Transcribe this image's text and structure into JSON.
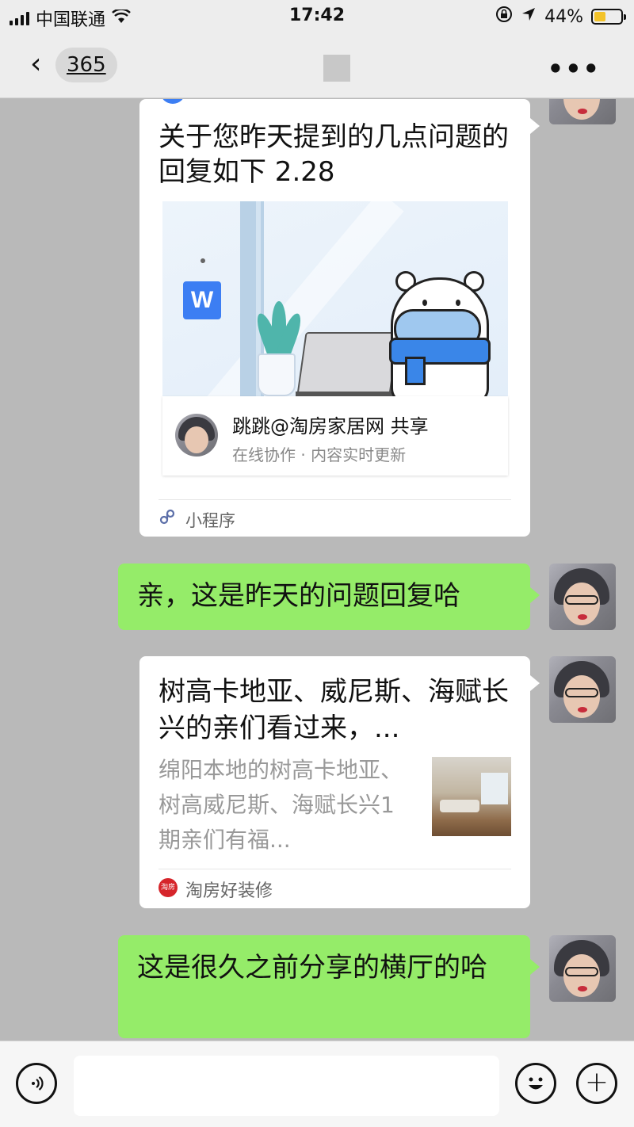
{
  "status_bar": {
    "carrier": "中国联通",
    "time": "17:42",
    "battery_percent": "44%",
    "battery_level": 0.44,
    "icons": [
      "signal-icon",
      "wifi-icon",
      "orientation-lock-icon",
      "location-icon",
      "battery-charging-icon"
    ]
  },
  "nav": {
    "back_icon": "chevron-left-icon",
    "unread_count": "365",
    "more_icon": "more-dots-icon"
  },
  "messages": {
    "wps_card": {
      "title": "关于您昨天提到的几点问题的回复如下 2.28",
      "preview_badge": "W",
      "sharer": "跳跳@淘房家居网 共享",
      "subtitle": "在线协作 · 内容实时更新",
      "footer_label": "小程序",
      "footer_icon": "mini-program-icon"
    },
    "text1": "亲，这是昨天的问题回复哈",
    "article_card": {
      "title": "树高卡地亚、威尼斯、海赋长兴的亲们看过来，...",
      "description": "绵阳本地的树高卡地亚、树高威尼斯、海赋长兴1期亲们有福...",
      "source_label": "淘房好装修",
      "source_icon_text": "淘房"
    },
    "text2": "这是很久之前分享的横厅的哈"
  },
  "input_bar": {
    "voice_icon": "voice-icon",
    "emoji_icon": "emoji-icon",
    "plus_icon": "plus-icon"
  },
  "colors": {
    "bubble_green": "#95ec69",
    "wps_blue": "#3c7ef3",
    "chat_background": "#b9b9b9"
  }
}
